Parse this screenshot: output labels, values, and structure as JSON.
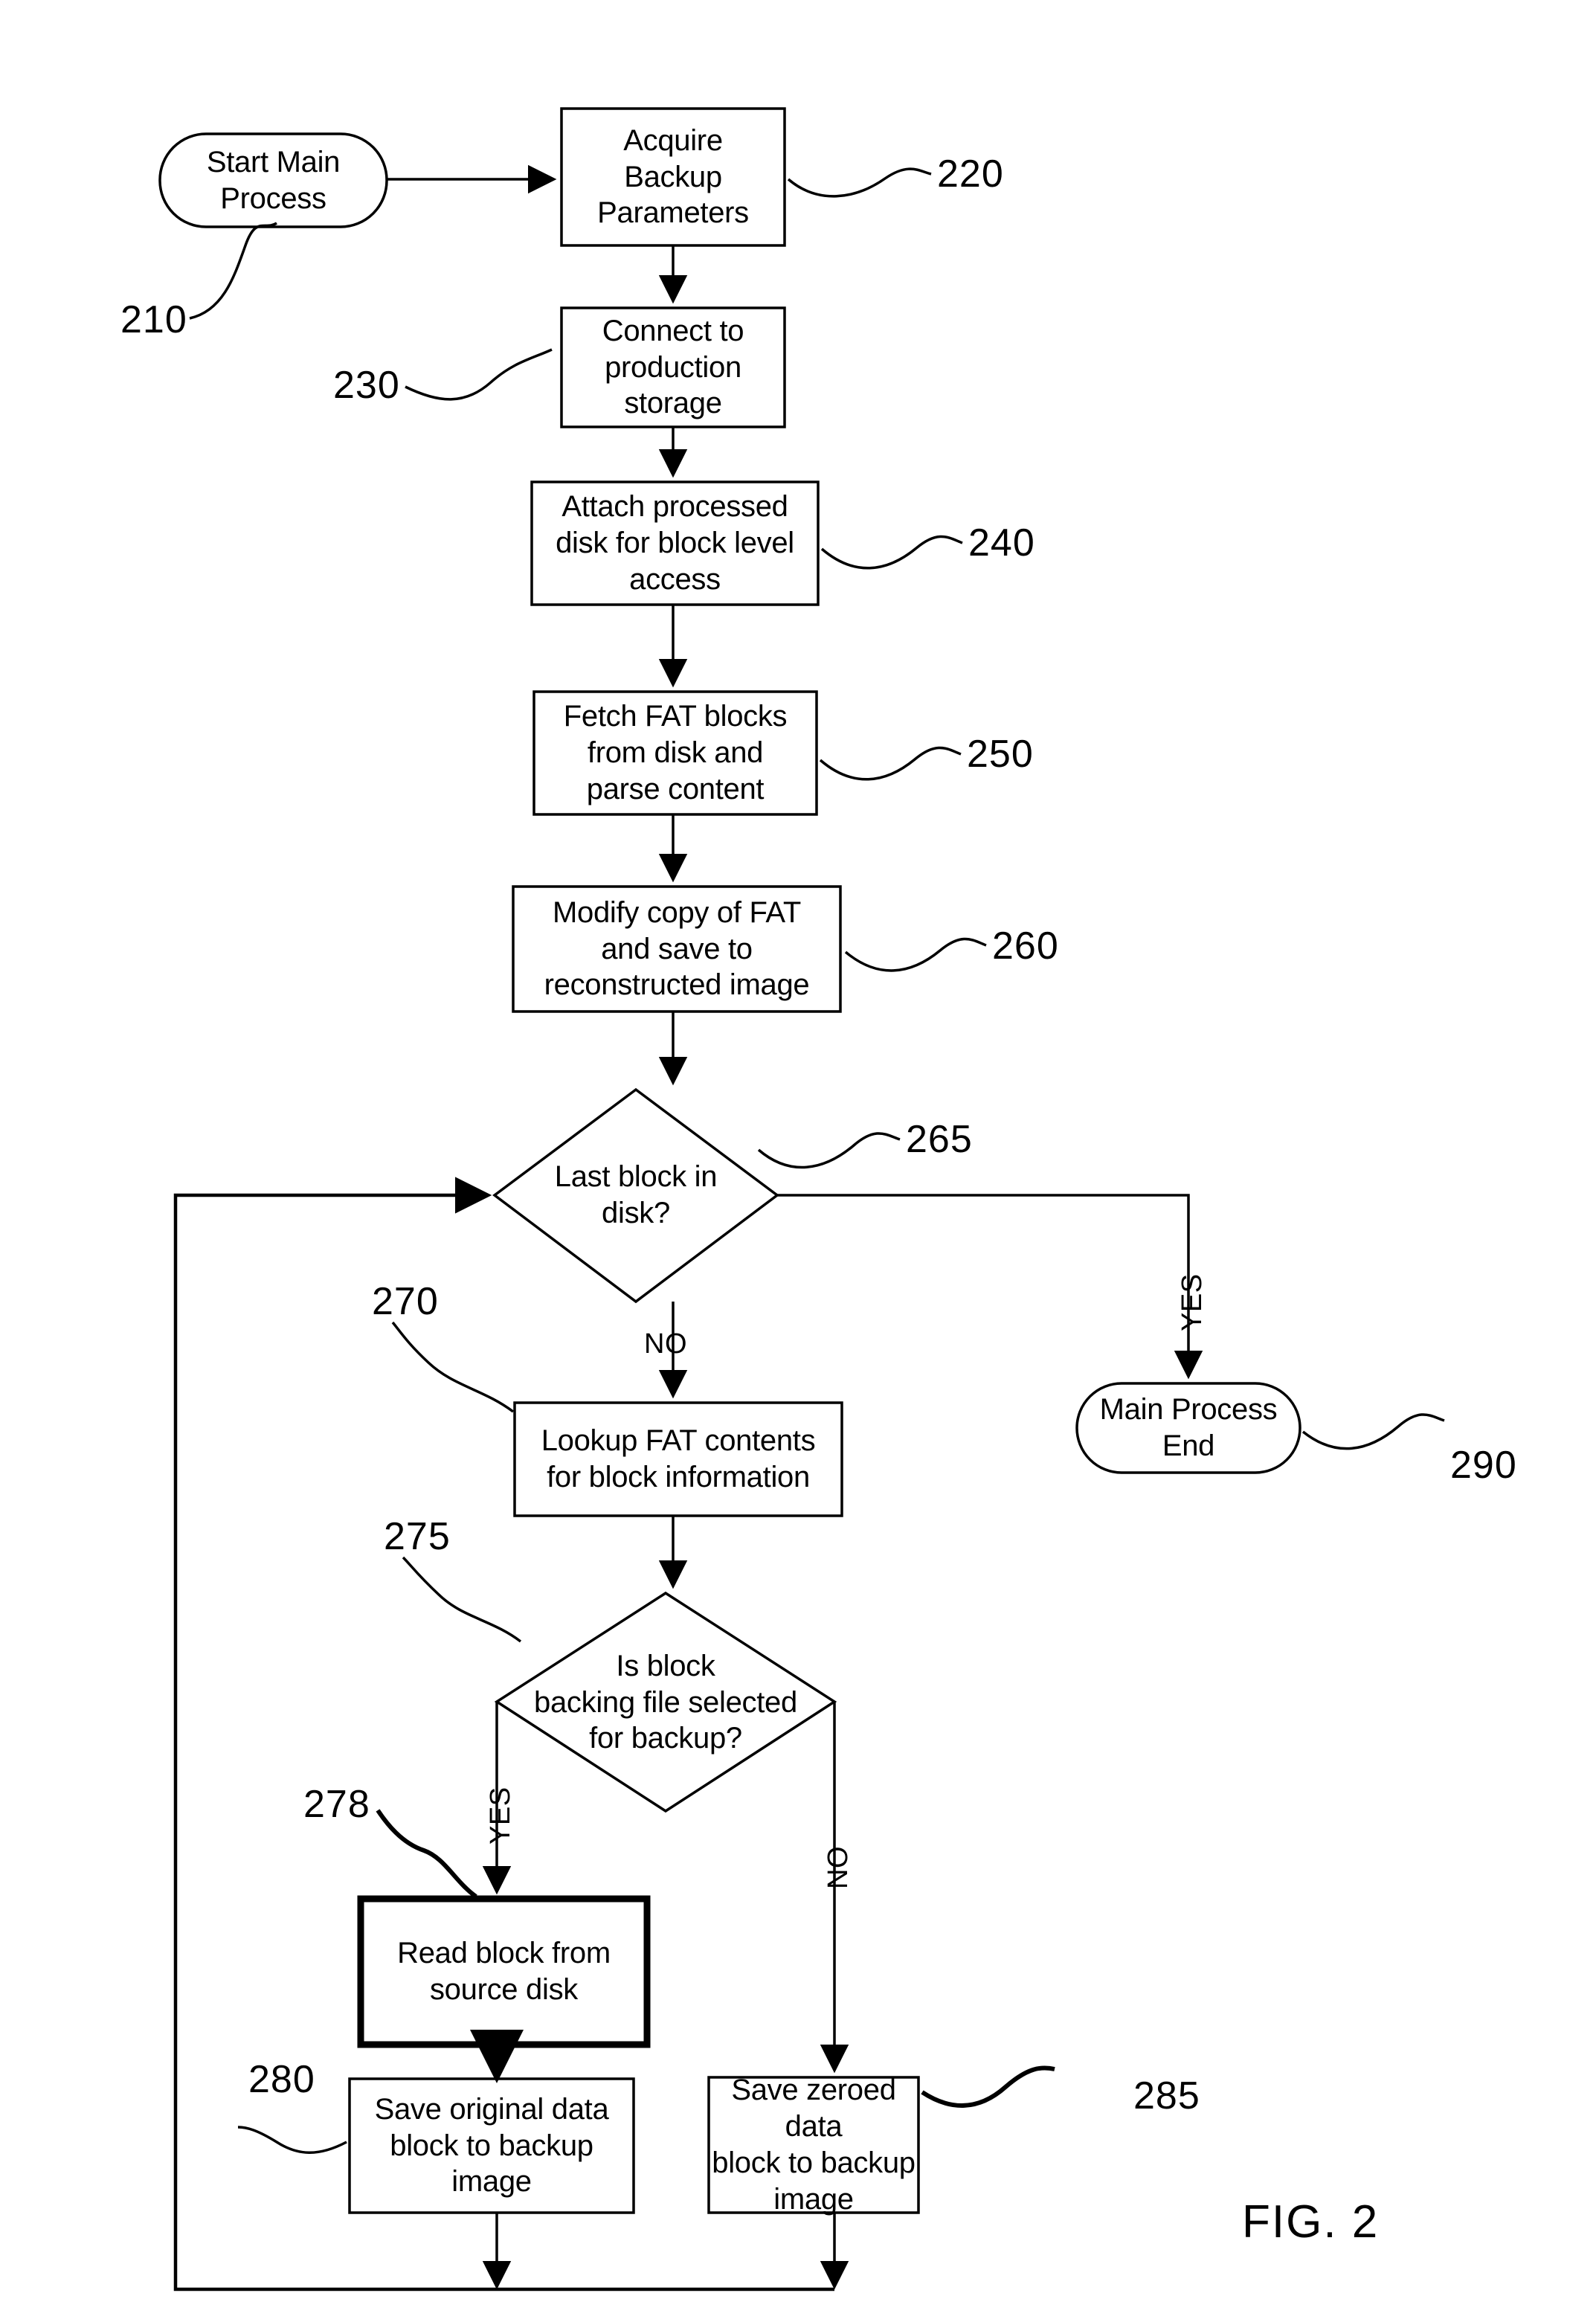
{
  "figure": {
    "caption": "FIG. 2",
    "title": "Main backup process flowchart"
  },
  "nodes": [
    {
      "id": "start",
      "ref": "210",
      "shape": "terminator",
      "label": "Start Main\nProcess"
    },
    {
      "id": "acquire",
      "ref": "220",
      "shape": "process",
      "label": "Acquire\nBackup\nParameters"
    },
    {
      "id": "connect",
      "ref": "230",
      "shape": "process",
      "label": "Connect to\nproduction\nstorage"
    },
    {
      "id": "attach",
      "ref": "240",
      "shape": "process",
      "label": "Attach processed\ndisk for block level\naccess"
    },
    {
      "id": "fetch",
      "ref": "250",
      "shape": "process",
      "label": "Fetch FAT blocks\nfrom disk and\nparse content"
    },
    {
      "id": "modify",
      "ref": "260",
      "shape": "process",
      "label": "Modify copy of FAT\nand save  to\nreconstructed image"
    },
    {
      "id": "last-block",
      "ref": "265",
      "shape": "decision",
      "label": "Last block in\ndisk?"
    },
    {
      "id": "main-end",
      "ref": "290",
      "shape": "terminator",
      "label": "Main Process\nEnd"
    },
    {
      "id": "lookup",
      "ref": "270",
      "shape": "process",
      "label": "Lookup FAT contents\nfor block information"
    },
    {
      "id": "is-backing",
      "ref": "275",
      "shape": "decision",
      "label": "Is block\nbacking file selected\nfor backup?"
    },
    {
      "id": "read-block",
      "ref": "278",
      "shape": "process-bold",
      "label": "Read block from\nsource disk"
    },
    {
      "id": "save-original",
      "ref": "280",
      "shape": "process",
      "label": "Save original data\nblock to backup\nimage"
    },
    {
      "id": "save-zeroed",
      "ref": "285",
      "shape": "process",
      "label": "Save zeroed data\nblock to backup\nimage"
    }
  ],
  "edge_labels": {
    "last_block_yes": "YES",
    "last_block_no": "NO",
    "is_backing_yes": "YES",
    "is_backing_no": "NO"
  },
  "reference_numerals": {
    "start": "210",
    "acquire": "220",
    "connect": "230",
    "attach": "240",
    "fetch": "250",
    "modify": "260",
    "last_block": "265",
    "lookup": "270",
    "is_backing": "275",
    "read_block": "278",
    "save_original": "280",
    "save_zeroed": "285",
    "main_end": "290"
  },
  "colors": {
    "ink": "#000000",
    "paper": "#ffffff"
  }
}
